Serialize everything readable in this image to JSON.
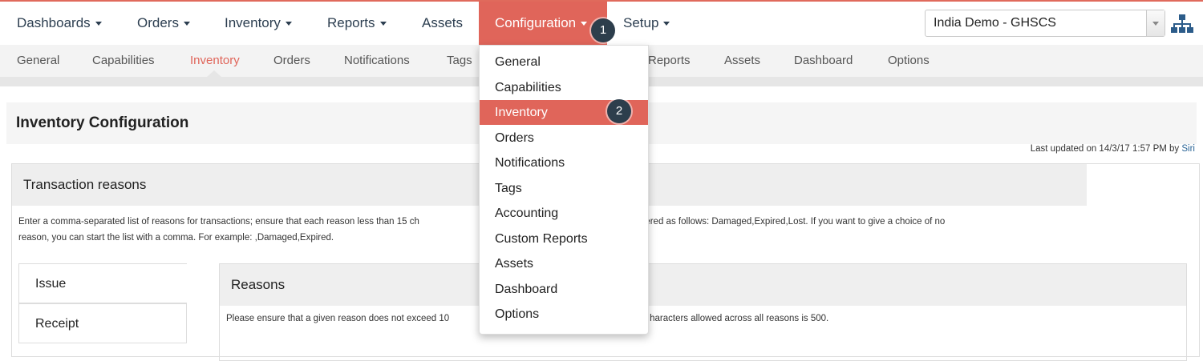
{
  "topnav": {
    "dashboards": "Dashboards",
    "orders": "Orders",
    "inventory": "Inventory",
    "reports": "Reports",
    "assets": "Assets",
    "configuration": "Configuration",
    "setup": "Setup"
  },
  "domain_select": {
    "value": "India Demo - GHSCS"
  },
  "subnav": [
    "General",
    "Capabilities",
    "Inventory",
    "Orders",
    "Notifications",
    "Tags",
    "Reports",
    "Assets",
    "Dashboard",
    "Options"
  ],
  "dropdown": [
    "General",
    "Capabilities",
    "Inventory",
    "Orders",
    "Notifications",
    "Tags",
    "Accounting",
    "Custom Reports",
    "Assets",
    "Dashboard",
    "Options"
  ],
  "badges": {
    "one": "1",
    "two": "2"
  },
  "page": {
    "title": "Inventory Configuration",
    "last_updated_prefix": "Last updated on 14/3/17 1:57 PM by ",
    "last_updated_user": "Siri"
  },
  "panel": {
    "title": "Transaction reasons",
    "desc_a": "Enter a comma-separated list of reasons for transactions; ensure that each reason less than 15 ch",
    "desc_b": "ons can be entered as follows: Damaged,Expired,Lost. If you want to give a choice of no",
    "desc_line2": "reason, you can start the list with a comma. For example: ,Damaged,Expired.",
    "tabs": {
      "issue": "Issue",
      "receipt": "Receipt"
    },
    "reasons_title": "Reasons",
    "reasons_note_a": "Please ensure that a given reason does not exceed 10",
    "reasons_note_b": "haracters allowed across all reasons is 500."
  },
  "colors": {
    "accent": "#e0655a",
    "nav_text": "#2c3e50",
    "badge": "#2d3e4c"
  },
  "icons": {
    "hierarchy": "hierarchy-icon",
    "caret": "caret-down-icon"
  }
}
